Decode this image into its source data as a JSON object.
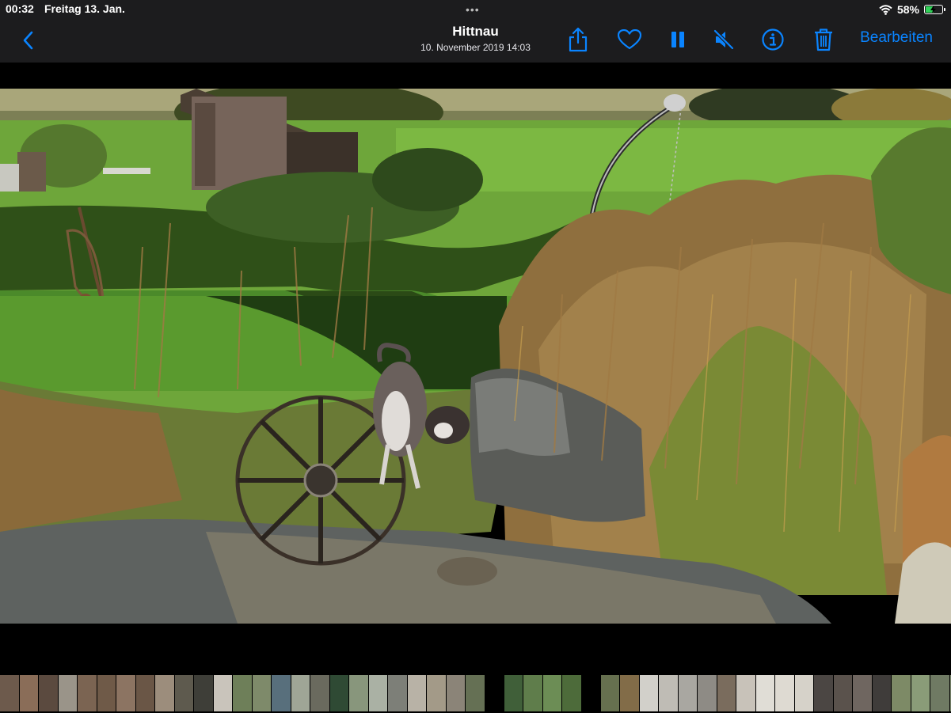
{
  "status_bar": {
    "time": "00:32",
    "date": "Freitag 13. Jan.",
    "battery_text": "58%",
    "battery_level": 0.58,
    "icons": [
      "wifi-icon",
      "battery-charging-icon"
    ]
  },
  "nav": {
    "title": "Hittnau",
    "subtitle": "10. November 2019  14:03",
    "edit_label": "Bearbeiten",
    "accent_color": "#0a84ff",
    "toolbar_icons": [
      "back-chevron-icon",
      "share-icon",
      "heart-icon",
      "pause-icon",
      "speaker-muted-icon",
      "info-icon",
      "trash-icon"
    ]
  },
  "filmstrip": {
    "thumbnail_colors": [
      "#6d5a4c",
      "#8a6d58",
      "#5b4a3f",
      "#9a9489",
      "#7b6452",
      "#6f5a48",
      "#8c7462",
      "#6a5646",
      "#9c8d7c",
      "#5e5a4e",
      "#3e3e38",
      "#c9c4bb",
      "#6e7f59",
      "#7e8a6a",
      "#586f7c",
      "#9fa596",
      "#6a6a5e",
      "#2f4a34",
      "#88967c",
      "#aab1a4",
      "#7d7f78",
      "#b8b2a6",
      "#a39a88",
      "#8b8478",
      "#657054",
      "#000000",
      "#405f39",
      "#5f7d4b",
      "#6c8d55",
      "#4d6b3a",
      "#000000",
      "#66704f",
      "#826c48",
      "#d2d0ca",
      "#bfbcb5",
      "#a9a7a1",
      "#8e8b85",
      "#7a6c5d",
      "#c8c2b9",
      "#e0ddd6",
      "#dedad2",
      "#d6d2c9",
      "#4b4643",
      "#5a524c",
      "#6f6660",
      "#3f3c3a",
      "#7d8a66",
      "#8a9c78",
      "#6f7a63",
      "#7c8a70",
      "#9aa288",
      "#6c7466",
      "#d9dbd8",
      "#c7c9c6",
      "#e4e4e2",
      "#b5b9c0"
    ]
  }
}
